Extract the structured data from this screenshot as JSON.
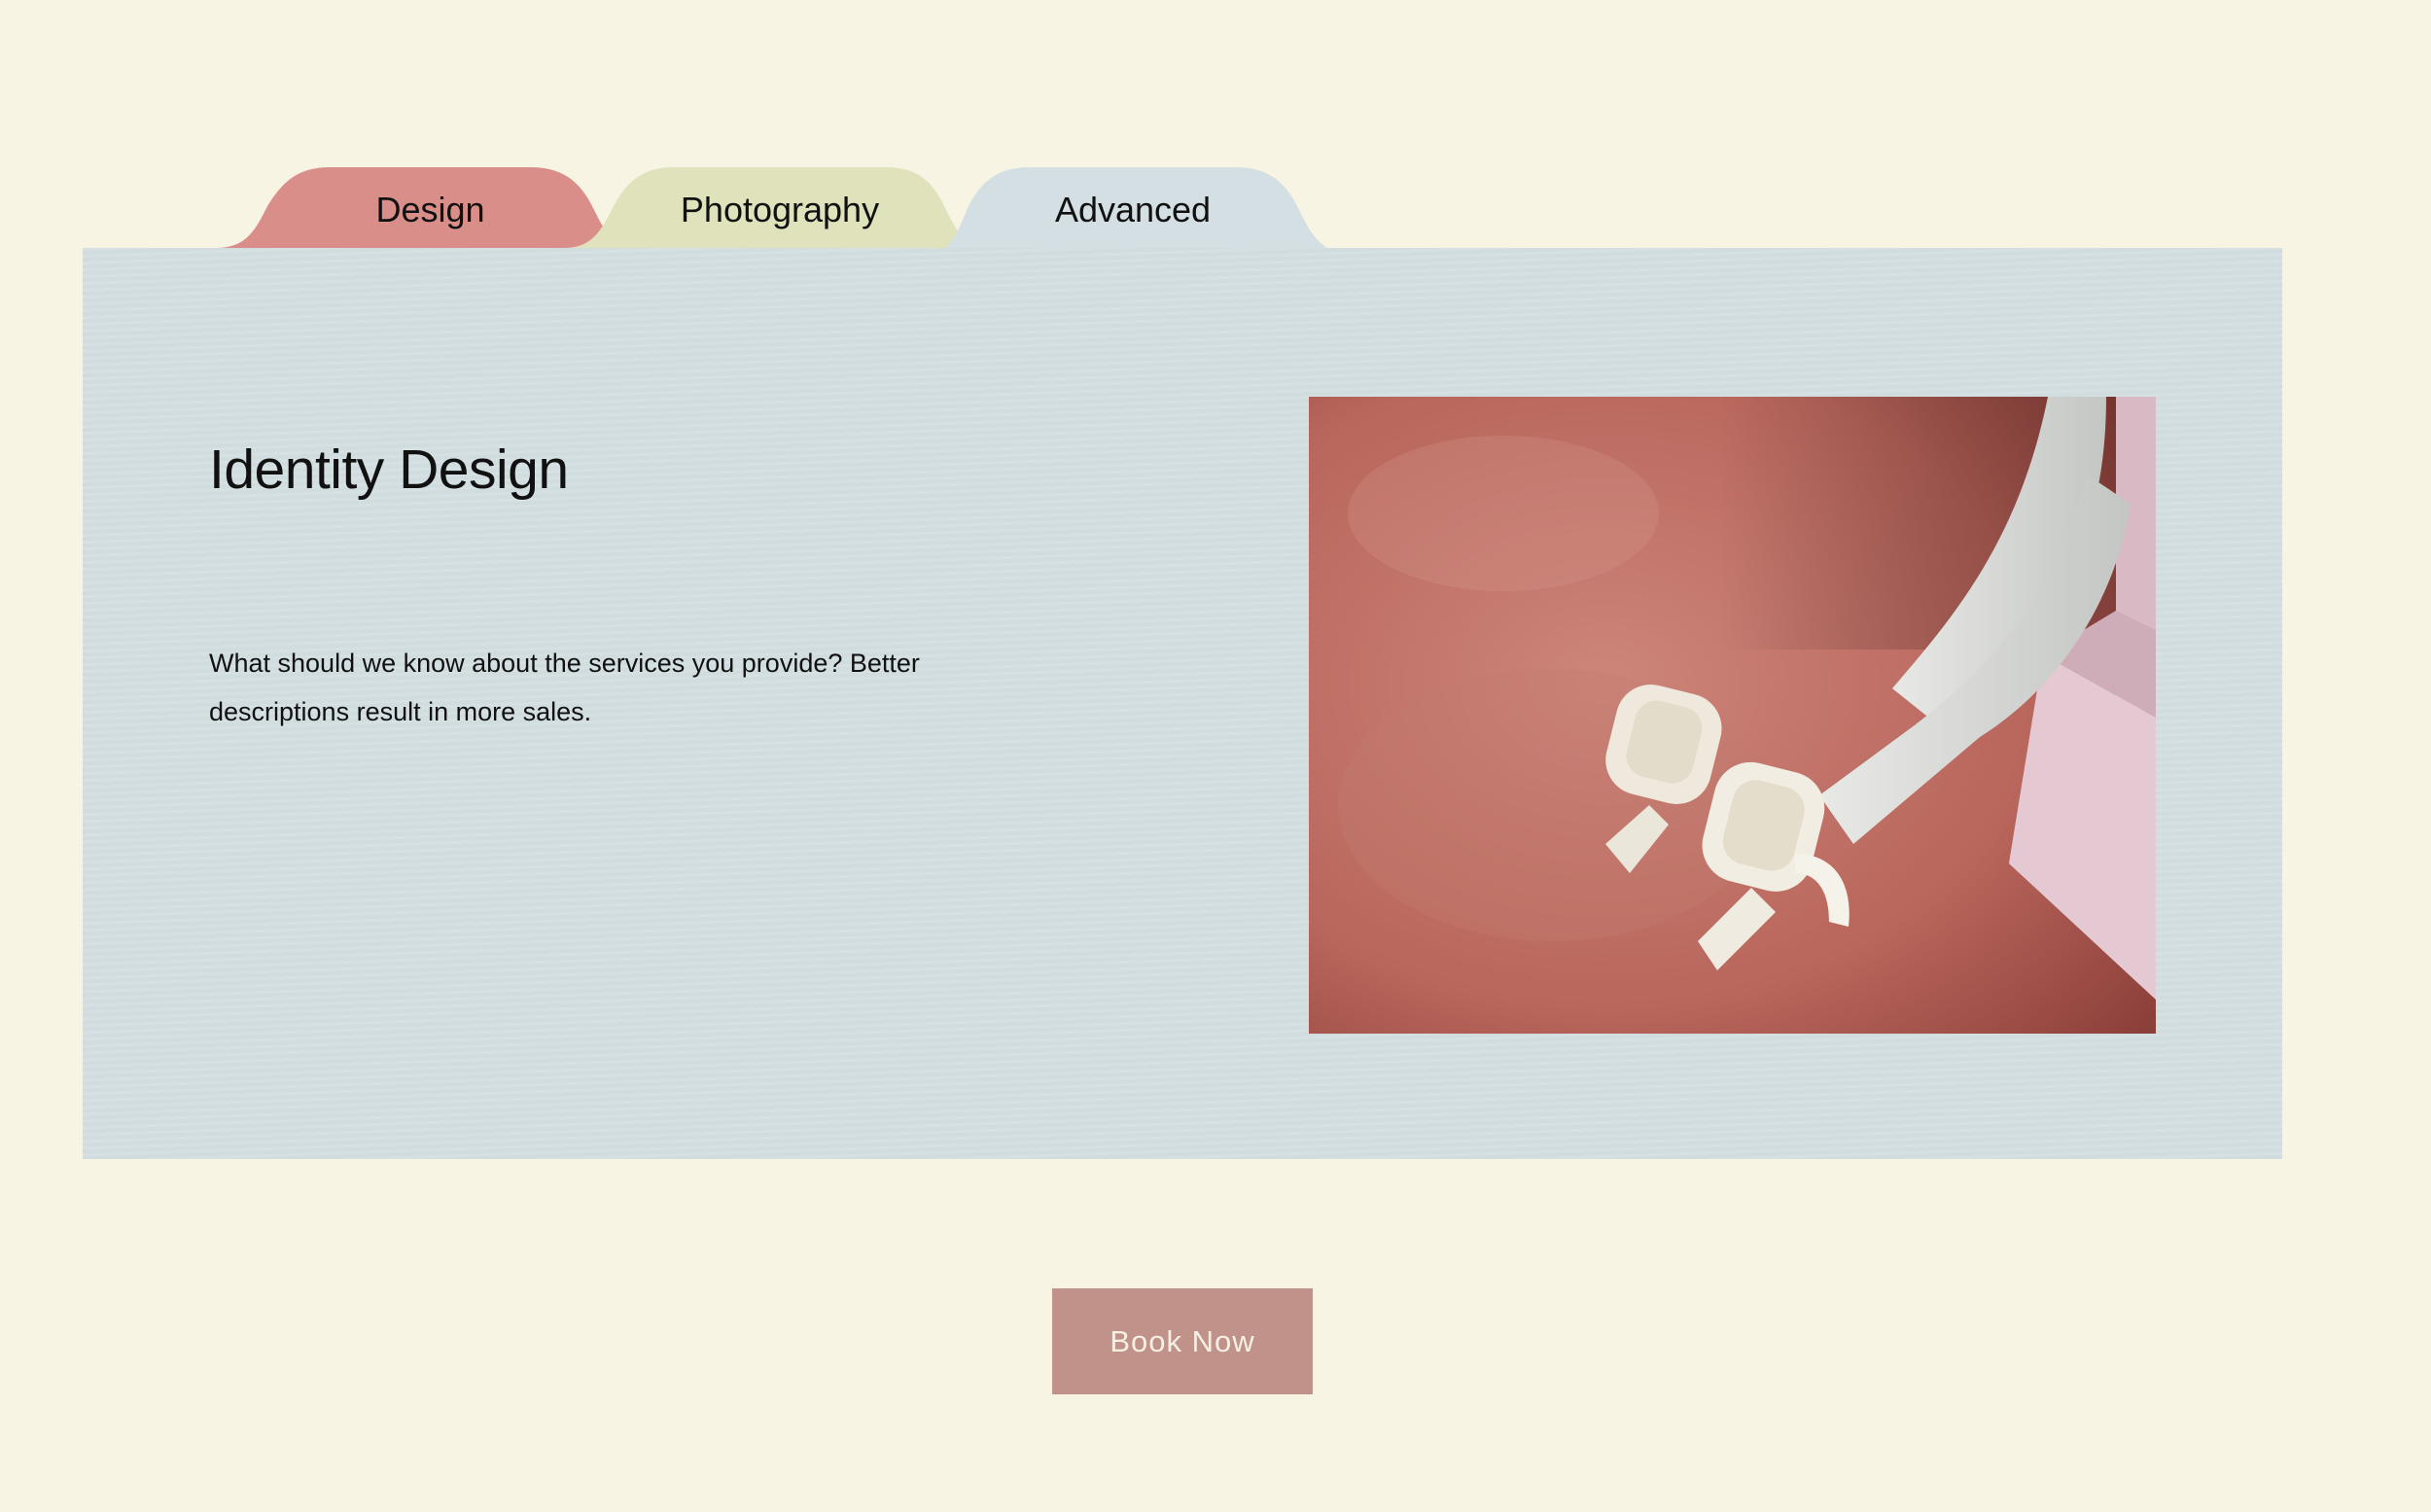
{
  "tabs": [
    {
      "label": "Design",
      "color": "#d98e8a"
    },
    {
      "label": "Photography",
      "color": "#dfe2ba"
    },
    {
      "label": "Advanced",
      "color": "#d3dfe2",
      "active": true
    }
  ],
  "panel": {
    "title": "Identity Design",
    "description": "What should we know about the services you provide? Better descriptions result in more sales.",
    "color": "#d3dfe2"
  },
  "cta": {
    "label": "Book Now",
    "color": "#c09289"
  },
  "colors": {
    "background": "#f7f4e3"
  }
}
